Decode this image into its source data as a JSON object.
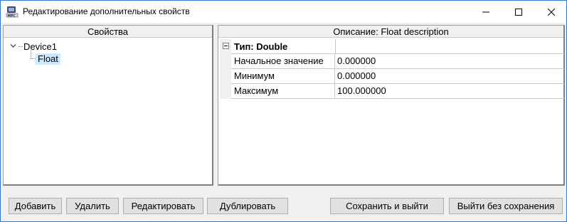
{
  "window": {
    "title": "Редактирование дополнительных свойств",
    "app_icon": "app-logo-icon",
    "controls": {
      "minimize_icon": "minimize-icon",
      "maximize_icon": "maximize-icon",
      "close_icon": "close-icon"
    }
  },
  "properties_panel": {
    "header": "Свойства",
    "tree": {
      "root": {
        "label": "Device1",
        "expanded": true
      },
      "children": [
        {
          "label": "Float",
          "selected": true
        }
      ]
    }
  },
  "description_panel": {
    "header": "Описание: Float description",
    "category": {
      "label": "Тип: Double",
      "expanded": true
    },
    "rows": [
      {
        "name": "Начальное значение",
        "value": "0.000000"
      },
      {
        "name": "Минимум",
        "value": "0.000000"
      },
      {
        "name": "Максимум",
        "value": "100.000000"
      }
    ]
  },
  "buttons": {
    "add": "Добавить",
    "delete": "Удалить",
    "edit": "Редактировать",
    "duplicate": "Дублировать",
    "save_exit": "Сохранить и выйти",
    "exit_no_save": "Выйти без сохранения"
  },
  "colors": {
    "selection": "#cce8ff",
    "window_border": "#2b7bd6",
    "button_face": "#e1e1e1"
  }
}
